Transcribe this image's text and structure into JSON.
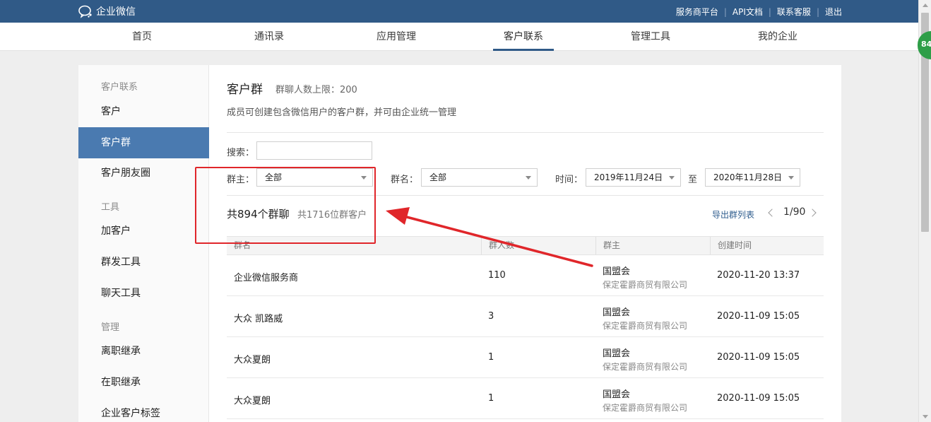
{
  "app": {
    "logo_text": "企业微信",
    "top_links": [
      "服务商平台",
      "API文档",
      "联系客服",
      "退出"
    ]
  },
  "nav": {
    "tabs": [
      "首页",
      "通讯录",
      "应用管理",
      "客户联系",
      "管理工具",
      "我的企业"
    ],
    "active": "客户联系"
  },
  "badge": {
    "text": "84"
  },
  "sidebar": {
    "group_customer": "客户联系",
    "customer": "客户",
    "customer_group": "客户群",
    "moments": "客户朋友圈",
    "group_tools": "工具",
    "add_customer": "加客户",
    "mass_send": "群发工具",
    "chat_tools": "聊天工具",
    "group_manage": "管理",
    "resign_inherit": "离职继承",
    "onjob_inherit": "在职继承",
    "customer_tags": "企业客户标签"
  },
  "page": {
    "title": "客户群",
    "subtitle": "群聊人数上限：200",
    "description": "成员可创建包含微信用户的客户群，并可由企业统一管理"
  },
  "filters": {
    "search_label": "搜索：",
    "search_value": "",
    "owner_label": "群主：",
    "owner_value": "全部",
    "name_label": "群名：",
    "name_value": "全部",
    "time_label": "时间：",
    "date_from": "2019年11月24日",
    "to_label": "至",
    "date_to": "2020年11月28日"
  },
  "summary": {
    "group_count": "共894个群聊",
    "customer_count": "共1716位群客户",
    "export_label": "导出群列表",
    "page_indicator": "1/90"
  },
  "table": {
    "headers": [
      "群名",
      "群人数",
      "群主",
      "创建时间"
    ],
    "rows": [
      {
        "name": "企业微信服务商",
        "members": "110",
        "owner": "国盟会",
        "owner_corp": "保定霍爵商贸有限公司",
        "created": "2020-11-20 13:37"
      },
      {
        "name": "大众 凯路威",
        "members": "3",
        "owner": "国盟会",
        "owner_corp": "保定霍爵商贸有限公司",
        "created": "2020-11-09 15:05"
      },
      {
        "name": "大众夏朗",
        "members": "1",
        "owner": "国盟会",
        "owner_corp": "保定霍爵商贸有限公司",
        "created": "2020-11-09 15:05"
      },
      {
        "name": "大众夏朗",
        "members": "1",
        "owner": "国盟会",
        "owner_corp": "保定霍爵商贸有限公司",
        "created": "2020-11-09 15:05"
      }
    ]
  },
  "colors": {
    "header_bg": "#305a87",
    "sidebar_active": "#4a7ab0",
    "annotation": "#e0262a"
  }
}
